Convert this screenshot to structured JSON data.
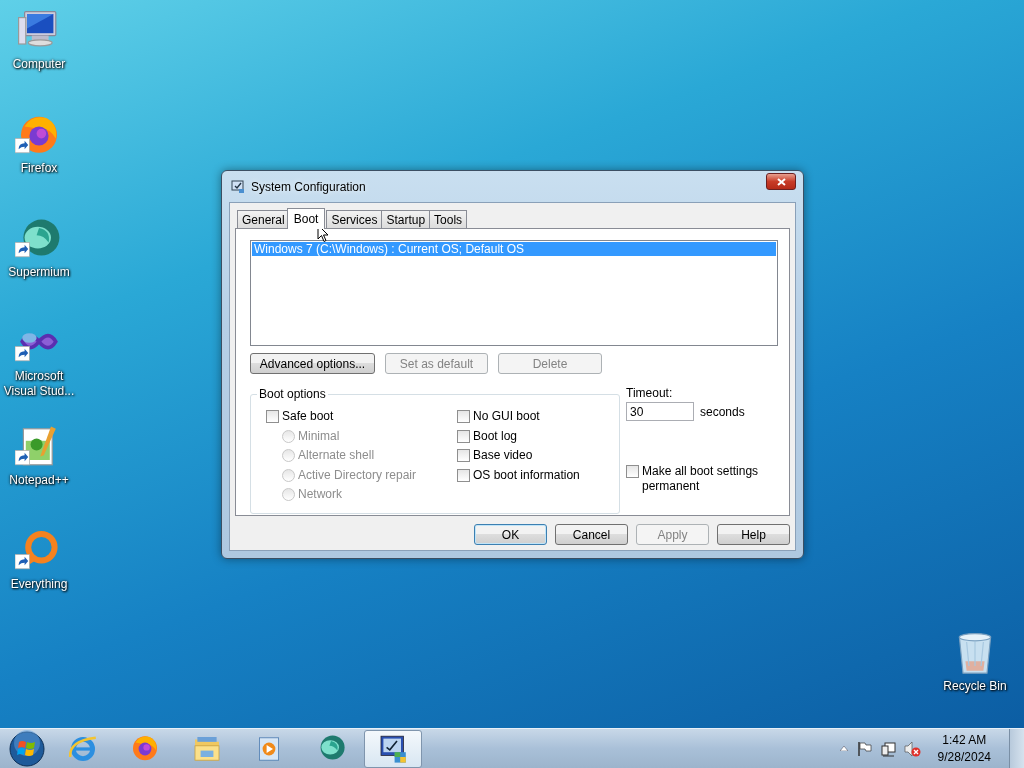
{
  "desktop_icons": [
    {
      "label": "Computer",
      "kind": "computer",
      "shortcut": false
    },
    {
      "label": "Firefox",
      "kind": "firefox",
      "shortcut": true
    },
    {
      "label": "Supermium",
      "kind": "supermium",
      "shortcut": true
    },
    {
      "label": "Microsoft Visual Stud...",
      "kind": "visualstudio",
      "shortcut": true
    },
    {
      "label": "Notepad++",
      "kind": "notepad",
      "shortcut": true
    },
    {
      "label": "Everything",
      "kind": "everything",
      "shortcut": true
    }
  ],
  "recycle_bin": {
    "label": "Recycle Bin"
  },
  "window": {
    "title": "System Configuration",
    "tabs": [
      {
        "label": "General",
        "selected": false
      },
      {
        "label": "Boot",
        "selected": true
      },
      {
        "label": "Services",
        "selected": false
      },
      {
        "label": "Startup",
        "selected": false
      },
      {
        "label": "Tools",
        "selected": false
      }
    ],
    "boot_entries": [
      {
        "label": "Windows 7 (C:\\Windows) : Current OS; Default OS",
        "selected": true
      }
    ],
    "entry_buttons": [
      {
        "label": "Advanced options...",
        "disabled": false
      },
      {
        "label": "Set as default",
        "disabled": true
      },
      {
        "label": "Delete",
        "disabled": true
      }
    ],
    "boot_options": {
      "title": "Boot options",
      "safe_boot": {
        "label": "Safe boot",
        "checked": false
      },
      "safe_modes": [
        {
          "label": "Minimal",
          "selected": false,
          "disabled": true
        },
        {
          "label": "Alternate shell",
          "selected": false,
          "disabled": true
        },
        {
          "label": "Active Directory repair",
          "selected": false,
          "disabled": true
        },
        {
          "label": "Network",
          "selected": false,
          "disabled": true
        }
      ],
      "flags": [
        {
          "label": "No GUI boot",
          "checked": false
        },
        {
          "label": "Boot log",
          "checked": false
        },
        {
          "label": "Base video",
          "checked": false
        },
        {
          "label": "OS boot information",
          "checked": false
        }
      ]
    },
    "timeout": {
      "label": "Timeout:",
      "value": "30",
      "unit": "seconds"
    },
    "permanent": {
      "label": "Make all boot settings permanent",
      "checked": false
    },
    "buttons": [
      {
        "label": "OK",
        "default": true,
        "disabled": false
      },
      {
        "label": "Cancel",
        "default": false,
        "disabled": false
      },
      {
        "label": "Apply",
        "default": false,
        "disabled": true
      },
      {
        "label": "Help",
        "default": false,
        "disabled": false
      }
    ]
  },
  "taskbar": {
    "apps": [
      {
        "kind": "ie",
        "active": false
      },
      {
        "kind": "firefox",
        "active": false
      },
      {
        "kind": "explorer",
        "active": false
      },
      {
        "kind": "media",
        "active": false
      },
      {
        "kind": "supermium",
        "active": false
      },
      {
        "kind": "msconfig",
        "active": true
      }
    ],
    "tray": {
      "volume_muted": true,
      "time": "1:42 AM",
      "date": "9/28/2024"
    }
  }
}
